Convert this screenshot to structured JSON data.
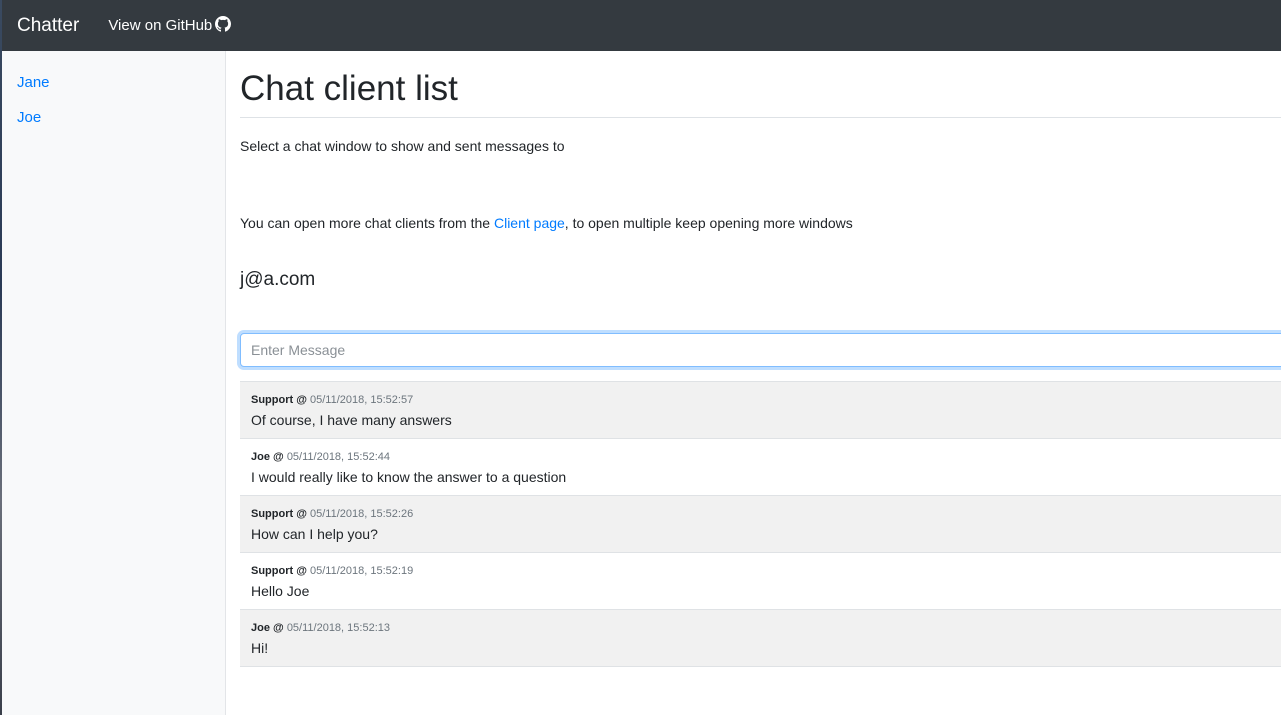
{
  "navbar": {
    "brand": "Chatter",
    "github_link": "View on GitHub",
    "github_icon": "github-icon"
  },
  "sidebar": {
    "items": [
      {
        "label": "Jane"
      },
      {
        "label": "Joe"
      }
    ]
  },
  "main": {
    "title": "Chat client list",
    "intro": "Select a chat window to show and sent messages to",
    "client_note_before": "You can open more chat clients from the ",
    "client_link": "Client page",
    "client_note_after": ", to open multiple keep opening more windows",
    "user_email": "j@a.com",
    "message_input": {
      "value": "",
      "placeholder": "Enter Message"
    },
    "messages": [
      {
        "author": "Support",
        "separator": " @ ",
        "timestamp": "05/11/2018, 15:52:57",
        "text": "Of course, I have many answers"
      },
      {
        "author": "Joe",
        "separator": " @ ",
        "timestamp": "05/11/2018, 15:52:44",
        "text": "I would really like to know the answer to a question"
      },
      {
        "author": "Support",
        "separator": " @ ",
        "timestamp": "05/11/2018, 15:52:26",
        "text": "How can I help you?"
      },
      {
        "author": "Support",
        "separator": " @ ",
        "timestamp": "05/11/2018, 15:52:19",
        "text": "Hello Joe"
      },
      {
        "author": "Joe",
        "separator": " @ ",
        "timestamp": "05/11/2018, 15:52:13",
        "text": "Hi!"
      }
    ]
  },
  "colors": {
    "navbar_bg": "#343a40",
    "link": "#007bff",
    "sidebar_bg": "#f8f9fa",
    "message_alt_bg": "#f1f1f1"
  }
}
